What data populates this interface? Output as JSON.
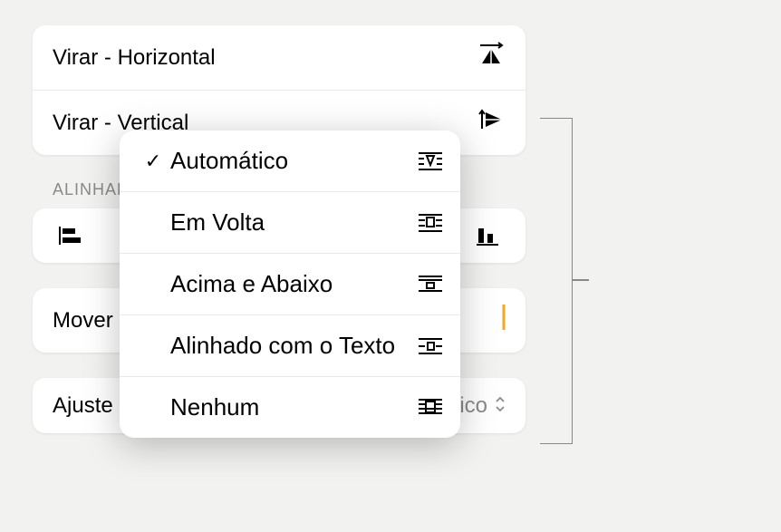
{
  "flip": {
    "horizontal_label": "Virar - Horizontal",
    "vertical_label": "Virar - Vertical"
  },
  "align_section_label": "ALINHAR",
  "move_label": "Mover",
  "text_wrap": {
    "label": "Ajuste de Texto",
    "value": "Automático"
  },
  "popup": {
    "items": [
      {
        "label": "Automático",
        "selected": true
      },
      {
        "label": "Em Volta",
        "selected": false
      },
      {
        "label": "Acima e Abaixo",
        "selected": false
      },
      {
        "label": "Alinhado com o Texto",
        "selected": false
      },
      {
        "label": "Nenhum",
        "selected": false
      }
    ]
  }
}
